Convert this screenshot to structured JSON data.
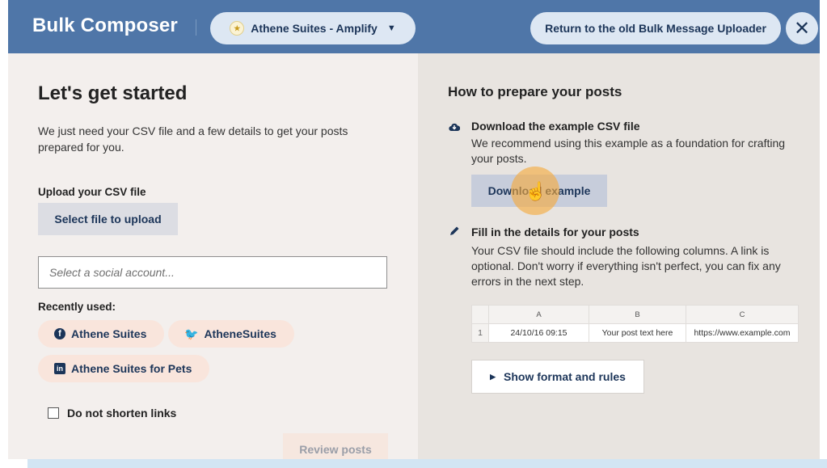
{
  "header": {
    "title": "Bulk Composer",
    "org_selector": "Athene Suites - Amplify",
    "return_button": "Return to the old Bulk Message Uploader",
    "close_symbol": "✕"
  },
  "left": {
    "heading": "Let's get started",
    "intro": "We just need your CSV file and a few details to get your posts prepared for you.",
    "upload_label": "Upload your CSV file",
    "upload_button": "Select file to upload",
    "account_placeholder": "Select a social account...",
    "recent_label": "Recently used:",
    "recent_accounts": [
      {
        "network_icon": "facebook-icon",
        "name": "Athene Suites"
      },
      {
        "network_icon": "twitter-icon",
        "name": "AtheneSuites"
      },
      {
        "network_icon": "linkedin-icon",
        "name": "Athene Suites for Pets"
      }
    ],
    "shorten_links_label": "Do not shorten links",
    "review_button": "Review posts"
  },
  "right": {
    "heading": "How to prepare your posts",
    "step1": {
      "icon": "cloud-download-icon",
      "title": "Download the example CSV file",
      "text": "We recommend using this example as a foundation for crafting your posts.",
      "button": "Download example"
    },
    "step2": {
      "icon": "pencil-icon",
      "title": "Fill in the details for your posts",
      "text": "Your CSV file should include the following columns. A link is optional. Don't worry if everything isn't perfect, you can fix any errors in the next step."
    },
    "csv_table": {
      "columns": [
        "A",
        "B",
        "C"
      ],
      "rows": [
        {
          "row_number": "1",
          "cells": [
            "24/10/16 09:15",
            "Your post text here",
            "https://www.example.com"
          ]
        }
      ]
    },
    "format_button": "Show format and rules"
  },
  "colors": {
    "header_bg": "#4f76a8",
    "pill_bg": "#dde7f3",
    "accent_text": "#1c3559",
    "left_panel_bg": "#f3efed",
    "right_panel_bg": "#e8e4e0",
    "chip_bg": "#f9e5dc",
    "cursor_highlight": "#f5aa3c"
  }
}
